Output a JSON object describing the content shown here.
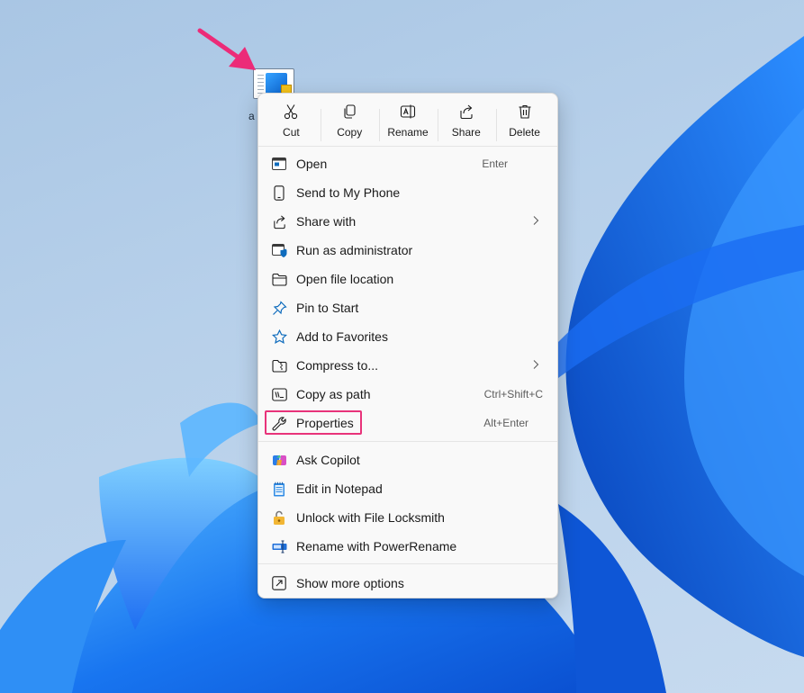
{
  "desktop": {
    "icon_caption": "a"
  },
  "quick_actions": [
    {
      "label": "Cut",
      "icon": "scissors-icon"
    },
    {
      "label": "Copy",
      "icon": "copy-icon"
    },
    {
      "label": "Rename",
      "icon": "rename-icon"
    },
    {
      "label": "Share",
      "icon": "share-icon"
    },
    {
      "label": "Delete",
      "icon": "trash-icon"
    }
  ],
  "menu": {
    "items": [
      {
        "label": "Open",
        "shortcut": "Enter",
        "icon": "open-window-icon"
      },
      {
        "label": "Send to My Phone",
        "icon": "phone-icon"
      },
      {
        "label": "Share with",
        "icon": "share-icon",
        "submenu": true
      },
      {
        "label": "Run as administrator",
        "icon": "shield-window-icon"
      },
      {
        "label": "Open file location",
        "icon": "folder-icon"
      },
      {
        "label": "Pin to Start",
        "icon": "pin-icon"
      },
      {
        "label": "Add to Favorites",
        "icon": "star-icon"
      },
      {
        "label": "Compress to...",
        "icon": "zip-folder-icon",
        "submenu": true
      },
      {
        "label": "Copy as path",
        "shortcut": "Ctrl+Shift+C",
        "icon": "path-icon"
      },
      {
        "label": "Properties",
        "shortcut": "Alt+Enter",
        "icon": "wrench-icon"
      }
    ],
    "extensions": [
      {
        "label": "Ask Copilot",
        "icon": "copilot-icon"
      },
      {
        "label": "Edit in Notepad",
        "icon": "notepad-icon"
      },
      {
        "label": "Unlock with File Locksmith",
        "icon": "lock-icon"
      },
      {
        "label": "Rename with PowerRename",
        "icon": "power-rename-icon"
      }
    ],
    "more": {
      "label": "Show more options",
      "icon": "open-external-icon"
    }
  },
  "colors": {
    "highlight": "#e8337a",
    "accent": "#0f6cbd",
    "menu_bg": "#f9f9f9"
  }
}
